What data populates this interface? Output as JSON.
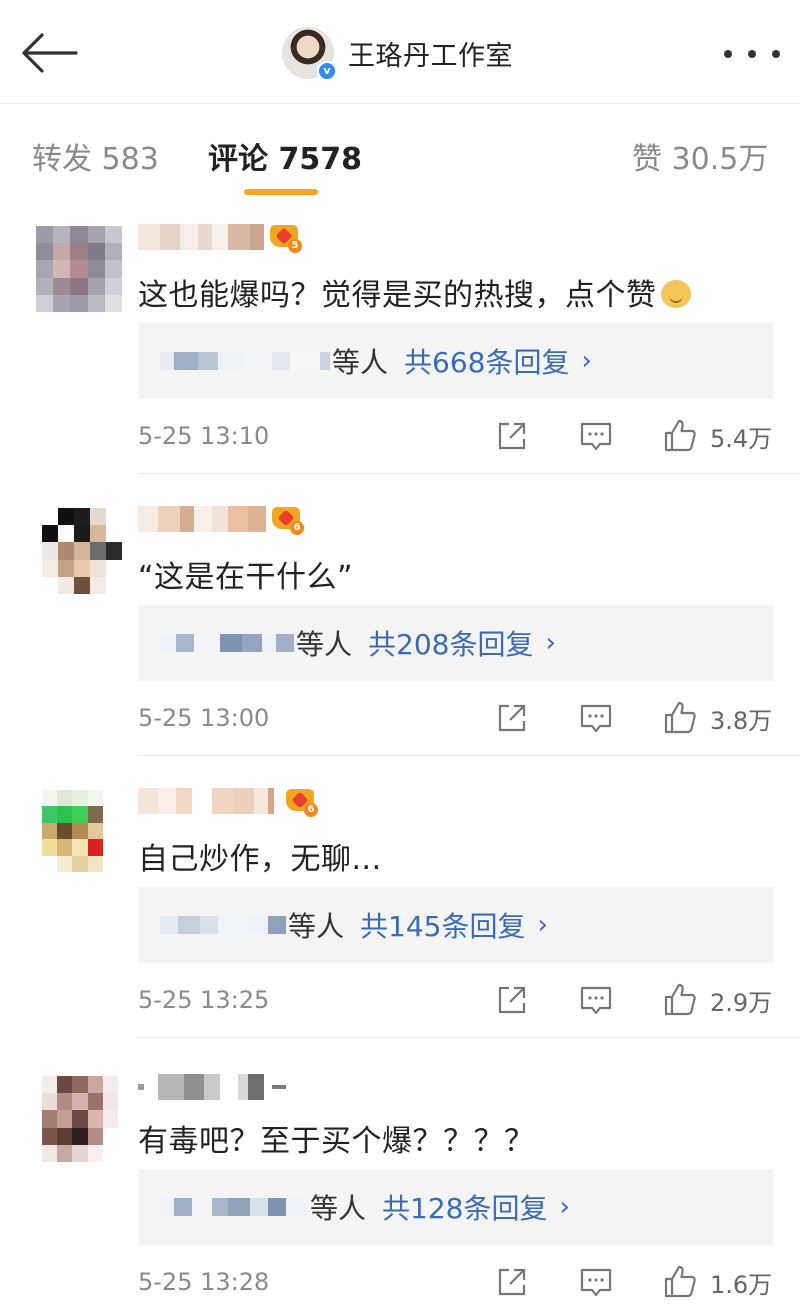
{
  "header": {
    "title": "王珞丹工作室",
    "verified_mark": "v",
    "back_icon": "arrow-left-icon",
    "more_icon": "more-dots-icon"
  },
  "tabs": [
    {
      "label": "转发 583",
      "active": false
    },
    {
      "label": "评论 7578",
      "active": true
    },
    {
      "label": "赞 30.5万",
      "active": false
    }
  ],
  "accent_color": "#f6a623",
  "link_color": "#3b6bb5",
  "comments": [
    {
      "badge_level": "5",
      "text": "这也能爆吗？觉得是买的热搜，点个赞",
      "has_emoji": true,
      "reply_others": "等人",
      "reply_count": "共668条回复",
      "reply_chevron": "›",
      "time": "5-25 13:10",
      "likes": "5.4万"
    },
    {
      "badge_level": "6",
      "text": "“这是在干什么”",
      "has_emoji": false,
      "reply_others": "等人",
      "reply_count": "共208条回复",
      "reply_chevron": "›",
      "time": "5-25 13:00",
      "likes": "3.8万"
    },
    {
      "badge_level": "6",
      "text": "自己炒作，无聊...",
      "has_emoji": false,
      "reply_others": "等人",
      "reply_count": "共145条回复",
      "reply_chevron": "›",
      "time": "5-25 13:25",
      "likes": "2.9万"
    },
    {
      "badge_level": "",
      "text": "有毒吧？至于买个爆？？？？",
      "has_emoji": false,
      "reply_others": "等人",
      "reply_count": "共128条回复",
      "reply_chevron": "›",
      "time": "5-25 13:28",
      "likes": "1.6万"
    }
  ]
}
